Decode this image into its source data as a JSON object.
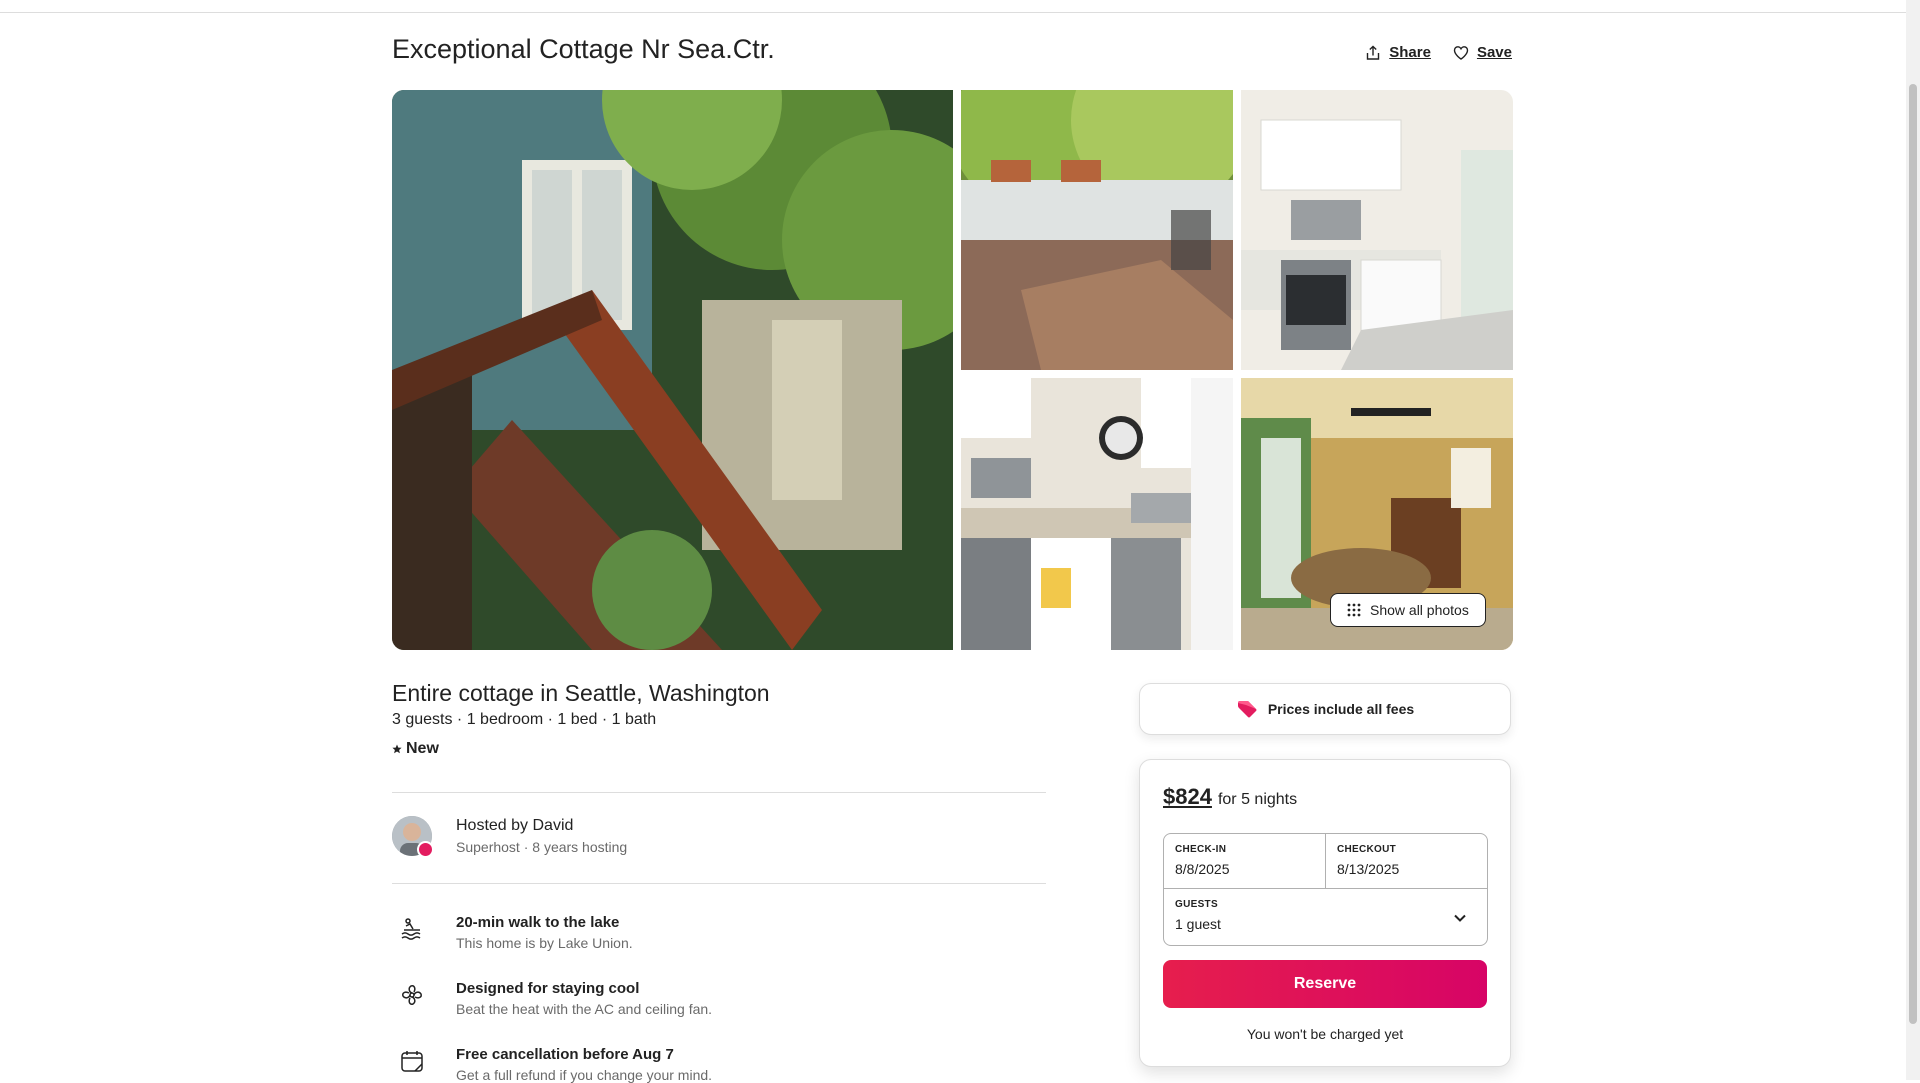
{
  "listing": {
    "title": "Exceptional Cottage Nr Sea.Ctr.",
    "share_label": "Share",
    "save_label": "Save",
    "show_all_photos": "Show all photos",
    "type": "Entire cottage in Seattle, Washington",
    "meta": "3 guests · 1 bedroom · 1 bed · 1 bath",
    "rating_label": "New"
  },
  "photos": [
    {
      "description": "backyard stairs and blue cottage"
    },
    {
      "description": "wooden deck with chairs"
    },
    {
      "description": "white kitchen with range"
    },
    {
      "description": "kitchen sink and dishwasher"
    },
    {
      "description": "dining area with open doors"
    }
  ],
  "host": {
    "name": "Hosted by David",
    "subtitle": "Superhost · 8 years hosting"
  },
  "highlights": [
    {
      "icon": "lake-icon",
      "title": "20-min walk to the lake",
      "subtitle": "This home is by Lake Union."
    },
    {
      "icon": "fan-icon",
      "title": "Designed for staying cool",
      "subtitle": "Beat the heat with the AC and ceiling fan."
    },
    {
      "icon": "calendar-icon",
      "title": "Free cancellation before Aug 7",
      "subtitle": "Get a full refund if you change your mind."
    }
  ],
  "booking": {
    "fees_notice": "Prices include all fees",
    "price": "$824",
    "price_suffix": "for 5 nights",
    "checkin_label": "CHECK-IN",
    "checkin_value": "8/8/2025",
    "checkout_label": "CHECKOUT",
    "checkout_value": "8/13/2025",
    "guests_label": "GUESTS",
    "guests_value": "1 guest",
    "reserve_label": "Reserve",
    "not_charged": "You won't be charged yet"
  },
  "colors": {
    "brand": "#e31c5f",
    "text": "#222222",
    "muted": "#6a6a6a",
    "border": "#dddddd"
  }
}
